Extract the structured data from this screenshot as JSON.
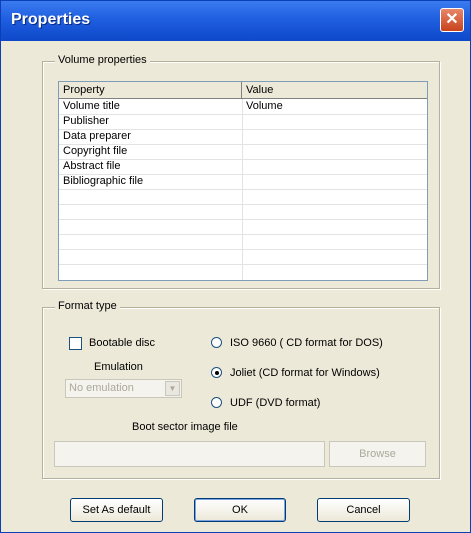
{
  "window": {
    "title": "Properties",
    "close_icon": "close-icon"
  },
  "volume_group": {
    "legend": "Volume properties",
    "columns": [
      "Property",
      "Value"
    ],
    "rows": [
      {
        "property": "Volume title",
        "value": "Volume"
      },
      {
        "property": "Publisher",
        "value": ""
      },
      {
        "property": "Data preparer",
        "value": ""
      },
      {
        "property": "Copyright file",
        "value": ""
      },
      {
        "property": "Abstract file",
        "value": ""
      },
      {
        "property": "Bibliographic file",
        "value": ""
      }
    ]
  },
  "format_group": {
    "legend": "Format type",
    "bootable_label": "Bootable disc",
    "bootable_checked": false,
    "emulation_label": "Emulation",
    "emulation_value": "No emulation",
    "format_options": [
      {
        "label": "ISO 9660  ( CD format for DOS)",
        "selected": false
      },
      {
        "label": "Joliet  (CD format for Windows)",
        "selected": true
      },
      {
        "label": "UDF (DVD format)",
        "selected": false
      }
    ],
    "boot_sector_label": "Boot sector image file",
    "boot_sector_value": "",
    "browse_label": "Browse"
  },
  "buttons": {
    "set_default": "Set As default",
    "ok": "OK",
    "cancel": "Cancel"
  }
}
